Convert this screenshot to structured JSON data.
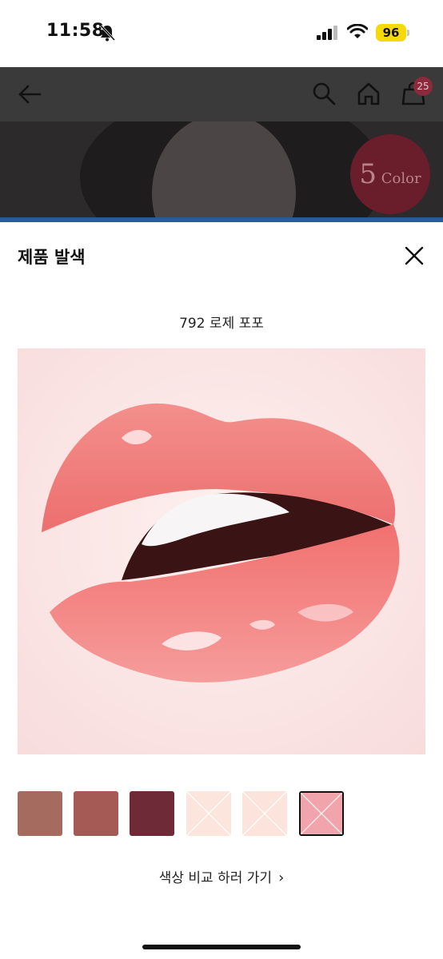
{
  "status": {
    "time": "11:58",
    "battery": "96"
  },
  "header": {
    "cart_count": "25"
  },
  "hero": {
    "badge_number": "5",
    "badge_text": "Color"
  },
  "sheet": {
    "title": "제품 발색",
    "shade_name": "792 로제 포포",
    "compare_link": "색상 비교 하러 가기"
  },
  "chips": [
    {
      "color": "#a46b5e",
      "available": true,
      "selected": false
    },
    {
      "color": "#a65a56",
      "available": true,
      "selected": false
    },
    {
      "color": "#6e2a36",
      "available": true,
      "selected": false
    },
    {
      "color": "#fbe5dd",
      "available": false,
      "selected": false
    },
    {
      "color": "#fce3dc",
      "available": false,
      "selected": false
    },
    {
      "color": "#f2a4ac",
      "available": false,
      "selected": true
    }
  ],
  "colors": {
    "accent_dark": "#111111",
    "lip": "#f07f7c",
    "background_skin": "#fce9e8"
  }
}
